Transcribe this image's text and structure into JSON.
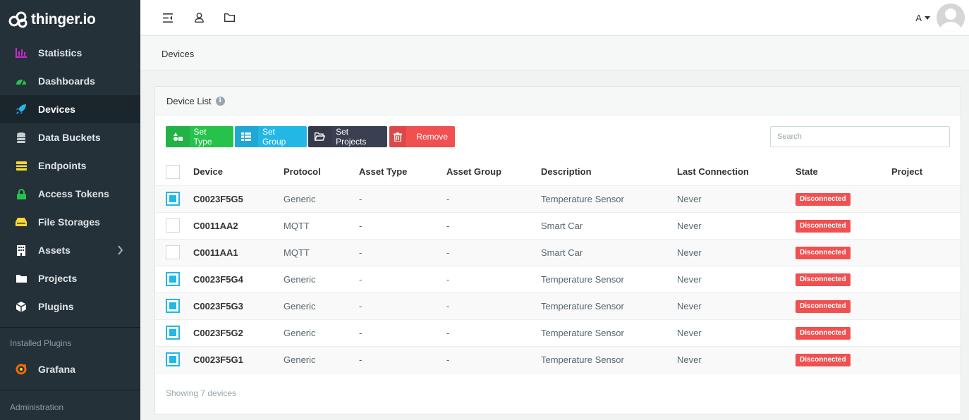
{
  "app": {
    "logo_text": "thinger.io"
  },
  "sidebar": {
    "items": [
      {
        "label": "Statistics",
        "icon": "bar-chart-icon",
        "color": "#c92bd6"
      },
      {
        "label": "Dashboards",
        "icon": "dashboard-icon",
        "color": "#27c24c"
      },
      {
        "label": "Devices",
        "icon": "rocket-icon",
        "color": "#23b7e5",
        "active": true
      },
      {
        "label": "Data Buckets",
        "icon": "database-icon",
        "color": "#c8cfd3"
      },
      {
        "label": "Endpoints",
        "icon": "endpoints-icon",
        "color": "#fad733"
      },
      {
        "label": "Access Tokens",
        "icon": "lock-icon",
        "color": "#27c24c"
      },
      {
        "label": "File Storages",
        "icon": "hdd-icon",
        "color": "#fad733"
      },
      {
        "label": "Assets",
        "icon": "building-icon",
        "color": "#ffffff"
      },
      {
        "label": "Projects",
        "icon": "folder-icon",
        "color": "#ffffff"
      },
      {
        "label": "Plugins",
        "icon": "cube-icon",
        "color": "#ffffff"
      }
    ],
    "installed_plugins_heading": "Installed Plugins",
    "plugins": [
      {
        "label": "Grafana",
        "icon": "grafana-icon",
        "color": "#f46800"
      }
    ],
    "administration_heading": "Administration"
  },
  "topbar": {
    "icons": [
      "menu-toggle-icon",
      "user-icon",
      "folder-icon"
    ],
    "user_initial": "A"
  },
  "breadcrumb": "Devices",
  "panel": {
    "title": "Device List",
    "buttons": {
      "set_type": "Set Type",
      "set_group": "Set Group",
      "set_projects": "Set Projects",
      "remove": "Remove"
    },
    "search_placeholder": "Search",
    "columns": [
      "Device",
      "Protocol",
      "Asset Type",
      "Asset Group",
      "Description",
      "Last Connection",
      "State",
      "Project"
    ],
    "rows": [
      {
        "checked": true,
        "device": "C0023F5G5",
        "protocol": "Generic",
        "asset_type": "-",
        "asset_group": "-",
        "description": "Temperature Sensor",
        "last_connection": "Never",
        "state": "Disconnected",
        "project": ""
      },
      {
        "checked": false,
        "device": "C0011AA2",
        "protocol": "MQTT",
        "asset_type": "-",
        "asset_group": "-",
        "description": "Smart Car",
        "last_connection": "Never",
        "state": "Disconnected",
        "project": ""
      },
      {
        "checked": false,
        "device": "C0011AA1",
        "protocol": "MQTT",
        "asset_type": "-",
        "asset_group": "-",
        "description": "Smart Car",
        "last_connection": "Never",
        "state": "Disconnected",
        "project": ""
      },
      {
        "checked": true,
        "device": "C0023F5G4",
        "protocol": "Generic",
        "asset_type": "-",
        "asset_group": "-",
        "description": "Temperature Sensor",
        "last_connection": "Never",
        "state": "Disconnected",
        "project": ""
      },
      {
        "checked": true,
        "device": "C0023F5G3",
        "protocol": "Generic",
        "asset_type": "-",
        "asset_group": "-",
        "description": "Temperature Sensor",
        "last_connection": "Never",
        "state": "Disconnected",
        "project": ""
      },
      {
        "checked": true,
        "device": "C0023F5G2",
        "protocol": "Generic",
        "asset_type": "-",
        "asset_group": "-",
        "description": "Temperature Sensor",
        "last_connection": "Never",
        "state": "Disconnected",
        "project": ""
      },
      {
        "checked": true,
        "device": "C0023F5G1",
        "protocol": "Generic",
        "asset_type": "-",
        "asset_group": "-",
        "description": "Temperature Sensor",
        "last_connection": "Never",
        "state": "Disconnected",
        "project": ""
      }
    ],
    "footer": "Showing 7 devices"
  },
  "colors": {
    "sidebar_bg": "#253139",
    "success": "#27c24c",
    "info": "#23b7e5",
    "dark": "#3a3f51",
    "danger": "#f05050"
  }
}
